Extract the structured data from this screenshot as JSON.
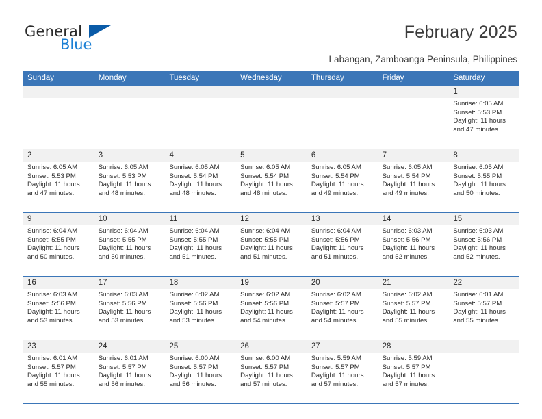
{
  "brand": {
    "name_part1": "General",
    "name_part2": "Blue",
    "triangle_color": "#0a5ba8",
    "blue_text_color": "#1a7fd4"
  },
  "header": {
    "title": "February 2025",
    "subtitle": "Labangan, Zamboanga Peninsula, Philippines"
  },
  "theme": {
    "header_blue": "#3b76b8",
    "daynum_strip": "#f1f1f1",
    "text": "#2b2b2b"
  },
  "weekdays": [
    "Sunday",
    "Monday",
    "Tuesday",
    "Wednesday",
    "Thursday",
    "Friday",
    "Saturday"
  ],
  "weeks": [
    [
      {
        "day": "",
        "sunrise": "",
        "sunset": "",
        "daylight": "",
        "daylight2": ""
      },
      {
        "day": "",
        "sunrise": "",
        "sunset": "",
        "daylight": "",
        "daylight2": ""
      },
      {
        "day": "",
        "sunrise": "",
        "sunset": "",
        "daylight": "",
        "daylight2": ""
      },
      {
        "day": "",
        "sunrise": "",
        "sunset": "",
        "daylight": "",
        "daylight2": ""
      },
      {
        "day": "",
        "sunrise": "",
        "sunset": "",
        "daylight": "",
        "daylight2": ""
      },
      {
        "day": "",
        "sunrise": "",
        "sunset": "",
        "daylight": "",
        "daylight2": ""
      },
      {
        "day": "1",
        "sunrise": "Sunrise: 6:05 AM",
        "sunset": "Sunset: 5:53 PM",
        "daylight": "Daylight: 11 hours",
        "daylight2": "and 47 minutes."
      }
    ],
    [
      {
        "day": "2",
        "sunrise": "Sunrise: 6:05 AM",
        "sunset": "Sunset: 5:53 PM",
        "daylight": "Daylight: 11 hours",
        "daylight2": "and 47 minutes."
      },
      {
        "day": "3",
        "sunrise": "Sunrise: 6:05 AM",
        "sunset": "Sunset: 5:53 PM",
        "daylight": "Daylight: 11 hours",
        "daylight2": "and 48 minutes."
      },
      {
        "day": "4",
        "sunrise": "Sunrise: 6:05 AM",
        "sunset": "Sunset: 5:54 PM",
        "daylight": "Daylight: 11 hours",
        "daylight2": "and 48 minutes."
      },
      {
        "day": "5",
        "sunrise": "Sunrise: 6:05 AM",
        "sunset": "Sunset: 5:54 PM",
        "daylight": "Daylight: 11 hours",
        "daylight2": "and 48 minutes."
      },
      {
        "day": "6",
        "sunrise": "Sunrise: 6:05 AM",
        "sunset": "Sunset: 5:54 PM",
        "daylight": "Daylight: 11 hours",
        "daylight2": "and 49 minutes."
      },
      {
        "day": "7",
        "sunrise": "Sunrise: 6:05 AM",
        "sunset": "Sunset: 5:54 PM",
        "daylight": "Daylight: 11 hours",
        "daylight2": "and 49 minutes."
      },
      {
        "day": "8",
        "sunrise": "Sunrise: 6:05 AM",
        "sunset": "Sunset: 5:55 PM",
        "daylight": "Daylight: 11 hours",
        "daylight2": "and 50 minutes."
      }
    ],
    [
      {
        "day": "9",
        "sunrise": "Sunrise: 6:04 AM",
        "sunset": "Sunset: 5:55 PM",
        "daylight": "Daylight: 11 hours",
        "daylight2": "and 50 minutes."
      },
      {
        "day": "10",
        "sunrise": "Sunrise: 6:04 AM",
        "sunset": "Sunset: 5:55 PM",
        "daylight": "Daylight: 11 hours",
        "daylight2": "and 50 minutes."
      },
      {
        "day": "11",
        "sunrise": "Sunrise: 6:04 AM",
        "sunset": "Sunset: 5:55 PM",
        "daylight": "Daylight: 11 hours",
        "daylight2": "and 51 minutes."
      },
      {
        "day": "12",
        "sunrise": "Sunrise: 6:04 AM",
        "sunset": "Sunset: 5:55 PM",
        "daylight": "Daylight: 11 hours",
        "daylight2": "and 51 minutes."
      },
      {
        "day": "13",
        "sunrise": "Sunrise: 6:04 AM",
        "sunset": "Sunset: 5:56 PM",
        "daylight": "Daylight: 11 hours",
        "daylight2": "and 51 minutes."
      },
      {
        "day": "14",
        "sunrise": "Sunrise: 6:03 AM",
        "sunset": "Sunset: 5:56 PM",
        "daylight": "Daylight: 11 hours",
        "daylight2": "and 52 minutes."
      },
      {
        "day": "15",
        "sunrise": "Sunrise: 6:03 AM",
        "sunset": "Sunset: 5:56 PM",
        "daylight": "Daylight: 11 hours",
        "daylight2": "and 52 minutes."
      }
    ],
    [
      {
        "day": "16",
        "sunrise": "Sunrise: 6:03 AM",
        "sunset": "Sunset: 5:56 PM",
        "daylight": "Daylight: 11 hours",
        "daylight2": "and 53 minutes."
      },
      {
        "day": "17",
        "sunrise": "Sunrise: 6:03 AM",
        "sunset": "Sunset: 5:56 PM",
        "daylight": "Daylight: 11 hours",
        "daylight2": "and 53 minutes."
      },
      {
        "day": "18",
        "sunrise": "Sunrise: 6:02 AM",
        "sunset": "Sunset: 5:56 PM",
        "daylight": "Daylight: 11 hours",
        "daylight2": "and 53 minutes."
      },
      {
        "day": "19",
        "sunrise": "Sunrise: 6:02 AM",
        "sunset": "Sunset: 5:56 PM",
        "daylight": "Daylight: 11 hours",
        "daylight2": "and 54 minutes."
      },
      {
        "day": "20",
        "sunrise": "Sunrise: 6:02 AM",
        "sunset": "Sunset: 5:57 PM",
        "daylight": "Daylight: 11 hours",
        "daylight2": "and 54 minutes."
      },
      {
        "day": "21",
        "sunrise": "Sunrise: 6:02 AM",
        "sunset": "Sunset: 5:57 PM",
        "daylight": "Daylight: 11 hours",
        "daylight2": "and 55 minutes."
      },
      {
        "day": "22",
        "sunrise": "Sunrise: 6:01 AM",
        "sunset": "Sunset: 5:57 PM",
        "daylight": "Daylight: 11 hours",
        "daylight2": "and 55 minutes."
      }
    ],
    [
      {
        "day": "23",
        "sunrise": "Sunrise: 6:01 AM",
        "sunset": "Sunset: 5:57 PM",
        "daylight": "Daylight: 11 hours",
        "daylight2": "and 55 minutes."
      },
      {
        "day": "24",
        "sunrise": "Sunrise: 6:01 AM",
        "sunset": "Sunset: 5:57 PM",
        "daylight": "Daylight: 11 hours",
        "daylight2": "and 56 minutes."
      },
      {
        "day": "25",
        "sunrise": "Sunrise: 6:00 AM",
        "sunset": "Sunset: 5:57 PM",
        "daylight": "Daylight: 11 hours",
        "daylight2": "and 56 minutes."
      },
      {
        "day": "26",
        "sunrise": "Sunrise: 6:00 AM",
        "sunset": "Sunset: 5:57 PM",
        "daylight": "Daylight: 11 hours",
        "daylight2": "and 57 minutes."
      },
      {
        "day": "27",
        "sunrise": "Sunrise: 5:59 AM",
        "sunset": "Sunset: 5:57 PM",
        "daylight": "Daylight: 11 hours",
        "daylight2": "and 57 minutes."
      },
      {
        "day": "28",
        "sunrise": "Sunrise: 5:59 AM",
        "sunset": "Sunset: 5:57 PM",
        "daylight": "Daylight: 11 hours",
        "daylight2": "and 57 minutes."
      },
      {
        "day": "",
        "sunrise": "",
        "sunset": "",
        "daylight": "",
        "daylight2": ""
      }
    ]
  ]
}
